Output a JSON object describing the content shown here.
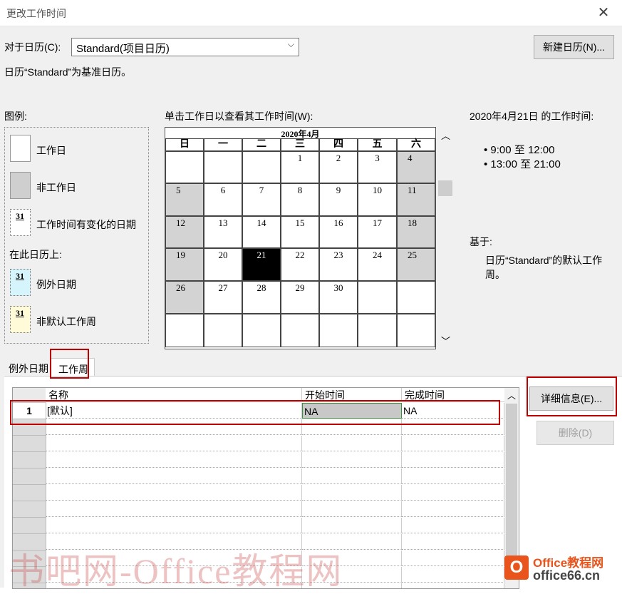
{
  "window": {
    "title": "更改工作时间"
  },
  "calendar_selector": {
    "label": "对于日历(C):",
    "value": "Standard(项目日历)",
    "info": "日历“Standard”为基准日历。"
  },
  "buttons": {
    "new_calendar": "新建日历(N)...",
    "details": "详细信息(E)...",
    "delete": "删除(D)"
  },
  "legend": {
    "title": "图例:",
    "items": [
      {
        "label": "工作日"
      },
      {
        "label": "非工作日"
      },
      {
        "label": "工作时间有变化的日期",
        "badge": "31"
      }
    ],
    "section": "在此日历上:",
    "calendar_items": [
      {
        "label": "例外日期",
        "badge": "31",
        "color": "#d6f4fb"
      },
      {
        "label": "非默认工作周",
        "badge": "31",
        "color": "#fffbd8"
      }
    ]
  },
  "calendar": {
    "instruction": "单击工作日以查看其工作时间(W):",
    "month_title": "2020年4月",
    "weekdays": [
      "日",
      "一",
      "二",
      "三",
      "四",
      "五",
      "六"
    ],
    "weeks": [
      [
        "",
        "",
        "",
        "1",
        "2",
        "3",
        "4"
      ],
      [
        "5",
        "6",
        "7",
        "8",
        "9",
        "10",
        "11"
      ],
      [
        "12",
        "13",
        "14",
        "15",
        "16",
        "17",
        "18"
      ],
      [
        "19",
        "20",
        "21",
        "22",
        "23",
        "24",
        "25"
      ],
      [
        "26",
        "27",
        "28",
        "29",
        "30",
        "",
        ""
      ],
      [
        "",
        "",
        "",
        "",
        "",
        "",
        ""
      ]
    ],
    "selected_day": "21"
  },
  "work_times": {
    "heading": "2020年4月21日 的工作时间:",
    "items": [
      "• 9:00 至 12:00",
      "• 13:00 至 21:00"
    ],
    "based_on_label": "基于:",
    "based_on_text_line1": "日历“Standard”的默认工作",
    "based_on_text_line2": "周。"
  },
  "tabs": [
    {
      "label": "例外日期"
    },
    {
      "label": "工作周"
    }
  ],
  "table": {
    "columns": [
      "名称",
      "开始时间",
      "完成时间"
    ],
    "rows": [
      {
        "num": "1",
        "name": "[默认]",
        "start": "NA",
        "finish": "NA"
      }
    ]
  },
  "watermark": {
    "text": "书吧网-Office教程网",
    "logo_line1": "Office教程网",
    "logo_line2": "office66.cn"
  },
  "colors": {
    "nonworking": "#d3d3d3",
    "selected": "#000000",
    "highlight": "#c00000",
    "start_cell": "#c8c8c8"
  }
}
